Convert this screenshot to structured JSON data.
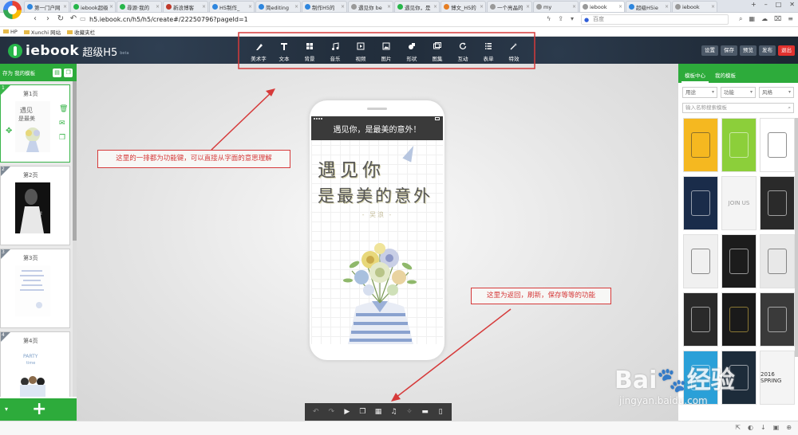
{
  "browser": {
    "tabs": [
      {
        "title": "第一门户网",
        "color": "#2e86de",
        "active": false
      },
      {
        "title": "iebook超级",
        "color": "#27b64a",
        "active": false
      },
      {
        "title": "尋源·我的",
        "color": "#27b64a",
        "active": false
      },
      {
        "title": "新浪博客",
        "color": "#c0392b",
        "active": false
      },
      {
        "title": "H5制作_",
        "color": "#2e86de",
        "active": false
      },
      {
        "title": "简editing",
        "color": "#2e86de",
        "active": false
      },
      {
        "title": "制作H5的",
        "color": "#2e86de",
        "active": false
      },
      {
        "title": "遇见你 be",
        "color": "#999999",
        "active": false
      },
      {
        "title": "遇见你，是",
        "color": "#27b64a",
        "active": false
      },
      {
        "title": "博文_H5的",
        "color": "#e67e22",
        "active": false
      },
      {
        "title": "一个亮晶的",
        "color": "#999999",
        "active": false
      },
      {
        "title": "my",
        "color": "#999999",
        "active": false
      },
      {
        "title": "iebook",
        "color": "#999999",
        "active": true
      },
      {
        "title": "超级H5ie",
        "color": "#2e86de",
        "active": false
      },
      {
        "title": "iebook",
        "color": "#999999",
        "active": false
      }
    ],
    "url": "h5.iebook.cn/h5/h5/create#/22250796?pageId=1",
    "search_placeholder": "百度",
    "bookmarks": [
      "HP",
      "Xunchi 网站",
      "收藏夹栏"
    ]
  },
  "editor": {
    "logo": "iebook",
    "logo_sub": "超级H5",
    "logo_tag": "beta",
    "toolbar": [
      {
        "label": "美术字",
        "icon": "pen-icon"
      },
      {
        "label": "文本",
        "icon": "text-icon"
      },
      {
        "label": "背景",
        "icon": "grid-icon"
      },
      {
        "label": "音乐",
        "icon": "music-icon"
      },
      {
        "label": "视频",
        "icon": "video-icon"
      },
      {
        "label": "图片",
        "icon": "image-icon"
      },
      {
        "label": "形状",
        "icon": "shape-icon"
      },
      {
        "label": "图集",
        "icon": "gallery-icon"
      },
      {
        "label": "互动",
        "icon": "refresh-icon"
      },
      {
        "label": "表单",
        "icon": "list-icon"
      },
      {
        "label": "特效",
        "icon": "effect-icon"
      }
    ],
    "header_buttons": [
      "设置",
      "保存",
      "预览",
      "发布",
      "退出"
    ]
  },
  "left_panel": {
    "header_label": "存为 我的模板",
    "pages": [
      {
        "num": "1",
        "label": "第1页"
      },
      {
        "num": "2",
        "label": "第2页"
      },
      {
        "num": "3",
        "label": "第3页"
      },
      {
        "num": "4",
        "label": "第4页"
      }
    ]
  },
  "phone": {
    "title": "遇见你，是最美的意外！",
    "line1": "遇见你",
    "line2": "是最美的意外",
    "author": "- 吴浪 -"
  },
  "annotations": {
    "toolbar_note": "这里的一排都为功能键，可以直接从字面的意思理解",
    "bottom_note": "这里为返回，刷新，保存等等的功能"
  },
  "right_panel": {
    "tabs": [
      "模板中心",
      "我的模板"
    ],
    "filters": [
      "用途",
      "功能",
      "风格"
    ],
    "search_placeholder": "输入名称搜索模板",
    "templates": [
      {
        "bg": "#f5b820",
        "fg": "#333"
      },
      {
        "bg": "#8ccf3a",
        "fg": "#fff"
      },
      {
        "bg": "#ffffff",
        "fg": "#333"
      },
      {
        "bg": "#1a2c4a",
        "fg": "#fff"
      },
      {
        "bg": "#f4f4f4",
        "fg": "#999",
        "text": "JOIN US"
      },
      {
        "bg": "#2a2a2a",
        "fg": "#fff"
      },
      {
        "bg": "#f0f0f0",
        "fg": "#333"
      },
      {
        "bg": "#1c1c1c",
        "fg": "#fff"
      },
      {
        "bg": "#e8e8e8",
        "fg": "#333"
      },
      {
        "bg": "#2a2a2a",
        "fg": "#fff"
      },
      {
        "bg": "#1a1a1a",
        "fg": "#e8c44a"
      },
      {
        "bg": "#3a3a3a",
        "fg": "#fff"
      },
      {
        "bg": "#2aa0d8",
        "fg": "#fff"
      },
      {
        "bg": "#1d2c3a",
        "fg": "#fff"
      },
      {
        "bg": "#f4f4f4",
        "fg": "#333",
        "text": "2016 SPRING"
      }
    ]
  },
  "watermark": {
    "brand": "Bai🐾经验",
    "site": "jingyan.baidu.com"
  }
}
